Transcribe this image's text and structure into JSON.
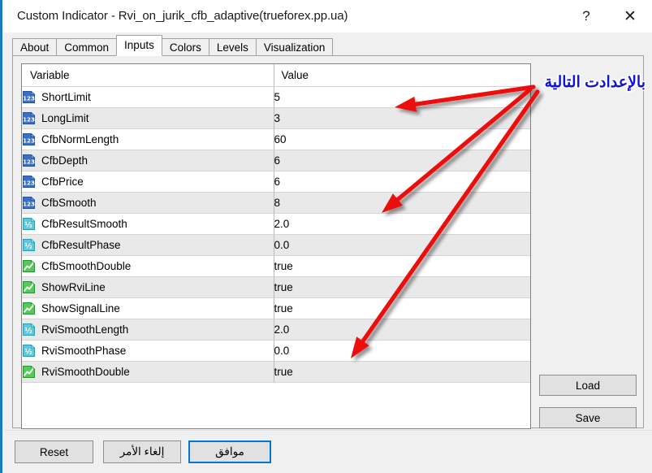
{
  "window": {
    "title": "Custom Indicator - Rvi_on_jurik_cfb_adaptive(trueforex.pp.ua)",
    "help_label": "?",
    "close_label": "✕",
    "accent_color": "#1a7bc4"
  },
  "tabs": [
    {
      "label": "About",
      "active": false
    },
    {
      "label": "Common",
      "active": false
    },
    {
      "label": "Inputs",
      "active": true
    },
    {
      "label": "Colors",
      "active": false
    },
    {
      "label": "Levels",
      "active": false
    },
    {
      "label": "Visualization",
      "active": false
    }
  ],
  "table": {
    "headers": {
      "variable": "Variable",
      "value": "Value"
    },
    "rows": [
      {
        "icon": "integer-icon",
        "variable": "ShortLimit",
        "value": "5"
      },
      {
        "icon": "integer-icon",
        "variable": "LongLimit",
        "value": "3"
      },
      {
        "icon": "integer-icon",
        "variable": "CfbNormLength",
        "value": "60"
      },
      {
        "icon": "integer-icon",
        "variable": "CfbDepth",
        "value": "6"
      },
      {
        "icon": "integer-icon",
        "variable": "CfbPrice",
        "value": "6"
      },
      {
        "icon": "integer-icon",
        "variable": "CfbSmooth",
        "value": "8"
      },
      {
        "icon": "double-icon",
        "variable": "CfbResultSmooth",
        "value": "2.0"
      },
      {
        "icon": "double-icon",
        "variable": "CfbResultPhase",
        "value": "0.0"
      },
      {
        "icon": "boolean-icon",
        "variable": "CfbSmoothDouble",
        "value": "true"
      },
      {
        "icon": "boolean-icon",
        "variable": "ShowRviLine",
        "value": "true"
      },
      {
        "icon": "boolean-icon",
        "variable": "ShowSignalLine",
        "value": "true"
      },
      {
        "icon": "double-icon",
        "variable": "RviSmoothLength",
        "value": "2.0"
      },
      {
        "icon": "double-icon",
        "variable": "RviSmoothPhase",
        "value": "0.0"
      },
      {
        "icon": "boolean-icon",
        "variable": "RviSmoothDouble",
        "value": "true"
      }
    ]
  },
  "side_buttons": {
    "load": "Load",
    "save": "Save"
  },
  "bottom_buttons": {
    "reset": "Reset",
    "cancel": "إلغاء الأمر",
    "ok": "موافق"
  },
  "annotation": {
    "text": "بالإعدادت التالية",
    "color": "#1111dd",
    "arrow_color": "#ee1111",
    "arrow_count": 3
  }
}
